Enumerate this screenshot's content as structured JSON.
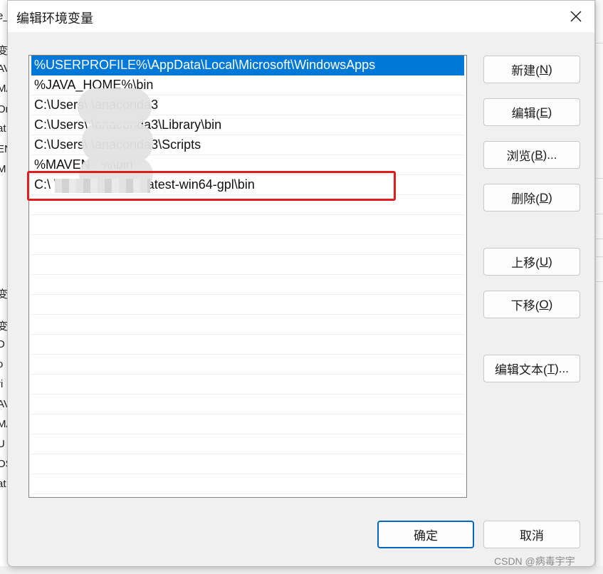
{
  "dialog": {
    "title": "编辑环境变量"
  },
  "path_list": {
    "items": [
      {
        "text": "%USERPROFILE%\\AppData\\Local\\Microsoft\\WindowsApps",
        "selected": true
      },
      {
        "text": "%JAVA_HOME%\\bin"
      },
      {
        "text": "C:\\Users\\              \\anaconda3"
      },
      {
        "text": "C:\\Users\\              \\anaconda3\\Library\\bin"
      },
      {
        "text": "C:\\Users\\              \\anaconda3\\Scripts"
      },
      {
        "text": "%MAVEN_               %\\bin"
      },
      {
        "text": "C:\\                       \\ffmpeg-master-latest-win64-gpl\\bin",
        "highlighted": true
      }
    ]
  },
  "buttons": {
    "new": {
      "label": "新建(",
      "key": "N",
      "end": ")"
    },
    "edit": {
      "label": "编辑(",
      "key": "E",
      "end": ")"
    },
    "browse": {
      "label": "浏览(",
      "key": "B",
      "end": ")..."
    },
    "delete": {
      "label": "删除(",
      "key": "D",
      "end": ")"
    },
    "move_up": {
      "label": "上移(",
      "key": "U",
      "end": ")"
    },
    "move_down": {
      "label": "下移(",
      "key": "O",
      "end": ")"
    },
    "edit_text": {
      "label": "编辑文本(",
      "key": "T",
      "end": ")..."
    },
    "ok": "确定",
    "cancel": "取消"
  },
  "watermark": "CSDN @病毒宇宇",
  "background_fragments": [
    "e_",
    "变量",
    "AV",
    "MA",
    "On",
    "at",
    "EN",
    "M",
    "变",
    "变量",
    "D",
    "o",
    "ri",
    "AV",
    "MA",
    "U",
    "OS",
    "at"
  ],
  "colors": {
    "selection": "#0078d7",
    "highlight_box": "#e01c1c",
    "primary_border": "#0067c0"
  }
}
